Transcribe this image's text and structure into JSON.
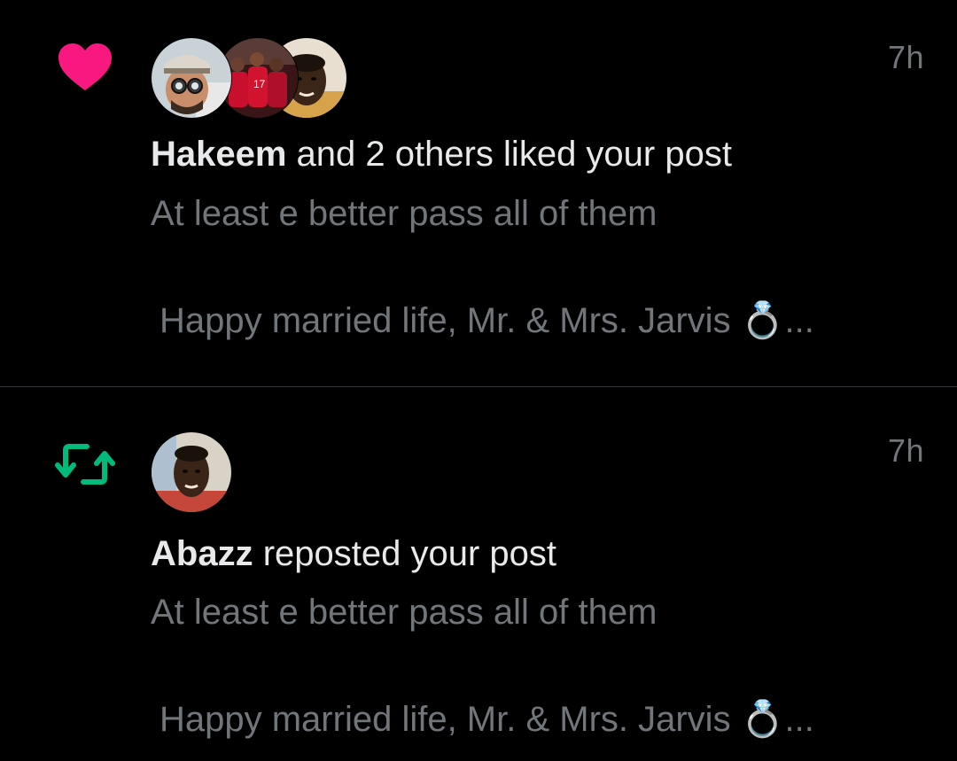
{
  "colors": {
    "background": "#000000",
    "divider": "#2f3336",
    "primary_text": "#e7e9ea",
    "secondary_text": "#71767b",
    "like_pink": "#f91880",
    "repost_green": "#00ba7c"
  },
  "notifications": [
    {
      "type": "like",
      "icon": "heart-icon",
      "time": "7h",
      "actor_name": "Hakeem",
      "action_text": " and 2 others liked your post",
      "post_line_1": "At least e better pass all of them",
      "post_line_2": "Happy married life, Mr. & Mrs. Jarvis 💍...",
      "avatars": [
        "avatar-hakeem",
        "avatar-football-team",
        "avatar-young-man"
      ]
    },
    {
      "type": "repost",
      "icon": "repost-icon",
      "time": "7h",
      "actor_name": "Abazz",
      "action_text": " reposted your post",
      "post_line_1": "At least e better pass all of them",
      "post_line_2": "Happy married life, Mr. & Mrs. Jarvis 💍...",
      "avatars": [
        "avatar-abazz"
      ]
    }
  ]
}
